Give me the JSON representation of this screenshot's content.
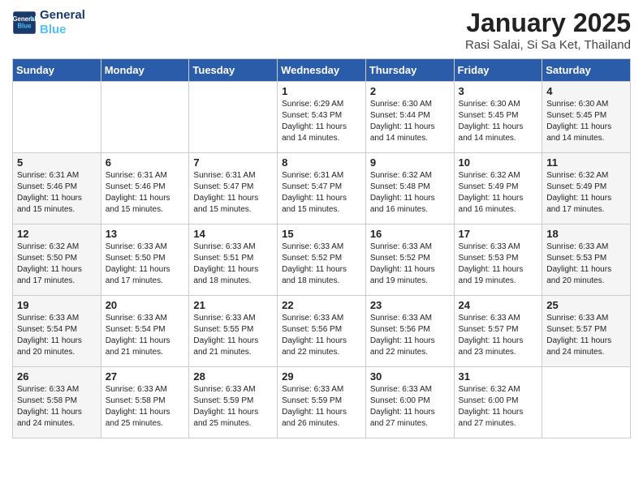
{
  "header": {
    "logo_line1": "General",
    "logo_line2": "Blue",
    "month": "January 2025",
    "location": "Rasi Salai, Si Sa Ket, Thailand"
  },
  "weekdays": [
    "Sunday",
    "Monday",
    "Tuesday",
    "Wednesday",
    "Thursday",
    "Friday",
    "Saturday"
  ],
  "weeks": [
    [
      {
        "day": "",
        "sunrise": "",
        "sunset": "",
        "daylight": "",
        "empty": true,
        "weekend": false
      },
      {
        "day": "",
        "sunrise": "",
        "sunset": "",
        "daylight": "",
        "empty": true,
        "weekend": false
      },
      {
        "day": "",
        "sunrise": "",
        "sunset": "",
        "daylight": "",
        "empty": true,
        "weekend": false
      },
      {
        "day": "1",
        "sunrise": "Sunrise: 6:29 AM",
        "sunset": "Sunset: 5:43 PM",
        "daylight": "Daylight: 11 hours and 14 minutes.",
        "empty": false,
        "weekend": false
      },
      {
        "day": "2",
        "sunrise": "Sunrise: 6:30 AM",
        "sunset": "Sunset: 5:44 PM",
        "daylight": "Daylight: 11 hours and 14 minutes.",
        "empty": false,
        "weekend": false
      },
      {
        "day": "3",
        "sunrise": "Sunrise: 6:30 AM",
        "sunset": "Sunset: 5:45 PM",
        "daylight": "Daylight: 11 hours and 14 minutes.",
        "empty": false,
        "weekend": false
      },
      {
        "day": "4",
        "sunrise": "Sunrise: 6:30 AM",
        "sunset": "Sunset: 5:45 PM",
        "daylight": "Daylight: 11 hours and 14 minutes.",
        "empty": false,
        "weekend": true
      }
    ],
    [
      {
        "day": "5",
        "sunrise": "Sunrise: 6:31 AM",
        "sunset": "Sunset: 5:46 PM",
        "daylight": "Daylight: 11 hours and 15 minutes.",
        "empty": false,
        "weekend": true
      },
      {
        "day": "6",
        "sunrise": "Sunrise: 6:31 AM",
        "sunset": "Sunset: 5:46 PM",
        "daylight": "Daylight: 11 hours and 15 minutes.",
        "empty": false,
        "weekend": false
      },
      {
        "day": "7",
        "sunrise": "Sunrise: 6:31 AM",
        "sunset": "Sunset: 5:47 PM",
        "daylight": "Daylight: 11 hours and 15 minutes.",
        "empty": false,
        "weekend": false
      },
      {
        "day": "8",
        "sunrise": "Sunrise: 6:31 AM",
        "sunset": "Sunset: 5:47 PM",
        "daylight": "Daylight: 11 hours and 15 minutes.",
        "empty": false,
        "weekend": false
      },
      {
        "day": "9",
        "sunrise": "Sunrise: 6:32 AM",
        "sunset": "Sunset: 5:48 PM",
        "daylight": "Daylight: 11 hours and 16 minutes.",
        "empty": false,
        "weekend": false
      },
      {
        "day": "10",
        "sunrise": "Sunrise: 6:32 AM",
        "sunset": "Sunset: 5:49 PM",
        "daylight": "Daylight: 11 hours and 16 minutes.",
        "empty": false,
        "weekend": false
      },
      {
        "day": "11",
        "sunrise": "Sunrise: 6:32 AM",
        "sunset": "Sunset: 5:49 PM",
        "daylight": "Daylight: 11 hours and 17 minutes.",
        "empty": false,
        "weekend": true
      }
    ],
    [
      {
        "day": "12",
        "sunrise": "Sunrise: 6:32 AM",
        "sunset": "Sunset: 5:50 PM",
        "daylight": "Daylight: 11 hours and 17 minutes.",
        "empty": false,
        "weekend": true
      },
      {
        "day": "13",
        "sunrise": "Sunrise: 6:33 AM",
        "sunset": "Sunset: 5:50 PM",
        "daylight": "Daylight: 11 hours and 17 minutes.",
        "empty": false,
        "weekend": false
      },
      {
        "day": "14",
        "sunrise": "Sunrise: 6:33 AM",
        "sunset": "Sunset: 5:51 PM",
        "daylight": "Daylight: 11 hours and 18 minutes.",
        "empty": false,
        "weekend": false
      },
      {
        "day": "15",
        "sunrise": "Sunrise: 6:33 AM",
        "sunset": "Sunset: 5:52 PM",
        "daylight": "Daylight: 11 hours and 18 minutes.",
        "empty": false,
        "weekend": false
      },
      {
        "day": "16",
        "sunrise": "Sunrise: 6:33 AM",
        "sunset": "Sunset: 5:52 PM",
        "daylight": "Daylight: 11 hours and 19 minutes.",
        "empty": false,
        "weekend": false
      },
      {
        "day": "17",
        "sunrise": "Sunrise: 6:33 AM",
        "sunset": "Sunset: 5:53 PM",
        "daylight": "Daylight: 11 hours and 19 minutes.",
        "empty": false,
        "weekend": false
      },
      {
        "day": "18",
        "sunrise": "Sunrise: 6:33 AM",
        "sunset": "Sunset: 5:53 PM",
        "daylight": "Daylight: 11 hours and 20 minutes.",
        "empty": false,
        "weekend": true
      }
    ],
    [
      {
        "day": "19",
        "sunrise": "Sunrise: 6:33 AM",
        "sunset": "Sunset: 5:54 PM",
        "daylight": "Daylight: 11 hours and 20 minutes.",
        "empty": false,
        "weekend": true
      },
      {
        "day": "20",
        "sunrise": "Sunrise: 6:33 AM",
        "sunset": "Sunset: 5:54 PM",
        "daylight": "Daylight: 11 hours and 21 minutes.",
        "empty": false,
        "weekend": false
      },
      {
        "day": "21",
        "sunrise": "Sunrise: 6:33 AM",
        "sunset": "Sunset: 5:55 PM",
        "daylight": "Daylight: 11 hours and 21 minutes.",
        "empty": false,
        "weekend": false
      },
      {
        "day": "22",
        "sunrise": "Sunrise: 6:33 AM",
        "sunset": "Sunset: 5:56 PM",
        "daylight": "Daylight: 11 hours and 22 minutes.",
        "empty": false,
        "weekend": false
      },
      {
        "day": "23",
        "sunrise": "Sunrise: 6:33 AM",
        "sunset": "Sunset: 5:56 PM",
        "daylight": "Daylight: 11 hours and 22 minutes.",
        "empty": false,
        "weekend": false
      },
      {
        "day": "24",
        "sunrise": "Sunrise: 6:33 AM",
        "sunset": "Sunset: 5:57 PM",
        "daylight": "Daylight: 11 hours and 23 minutes.",
        "empty": false,
        "weekend": false
      },
      {
        "day": "25",
        "sunrise": "Sunrise: 6:33 AM",
        "sunset": "Sunset: 5:57 PM",
        "daylight": "Daylight: 11 hours and 24 minutes.",
        "empty": false,
        "weekend": true
      }
    ],
    [
      {
        "day": "26",
        "sunrise": "Sunrise: 6:33 AM",
        "sunset": "Sunset: 5:58 PM",
        "daylight": "Daylight: 11 hours and 24 minutes.",
        "empty": false,
        "weekend": true
      },
      {
        "day": "27",
        "sunrise": "Sunrise: 6:33 AM",
        "sunset": "Sunset: 5:58 PM",
        "daylight": "Daylight: 11 hours and 25 minutes.",
        "empty": false,
        "weekend": false
      },
      {
        "day": "28",
        "sunrise": "Sunrise: 6:33 AM",
        "sunset": "Sunset: 5:59 PM",
        "daylight": "Daylight: 11 hours and 25 minutes.",
        "empty": false,
        "weekend": false
      },
      {
        "day": "29",
        "sunrise": "Sunrise: 6:33 AM",
        "sunset": "Sunset: 5:59 PM",
        "daylight": "Daylight: 11 hours and 26 minutes.",
        "empty": false,
        "weekend": false
      },
      {
        "day": "30",
        "sunrise": "Sunrise: 6:33 AM",
        "sunset": "Sunset: 6:00 PM",
        "daylight": "Daylight: 11 hours and 27 minutes.",
        "empty": false,
        "weekend": false
      },
      {
        "day": "31",
        "sunrise": "Sunrise: 6:32 AM",
        "sunset": "Sunset: 6:00 PM",
        "daylight": "Daylight: 11 hours and 27 minutes.",
        "empty": false,
        "weekend": false
      },
      {
        "day": "",
        "sunrise": "",
        "sunset": "",
        "daylight": "",
        "empty": true,
        "weekend": true
      }
    ]
  ]
}
